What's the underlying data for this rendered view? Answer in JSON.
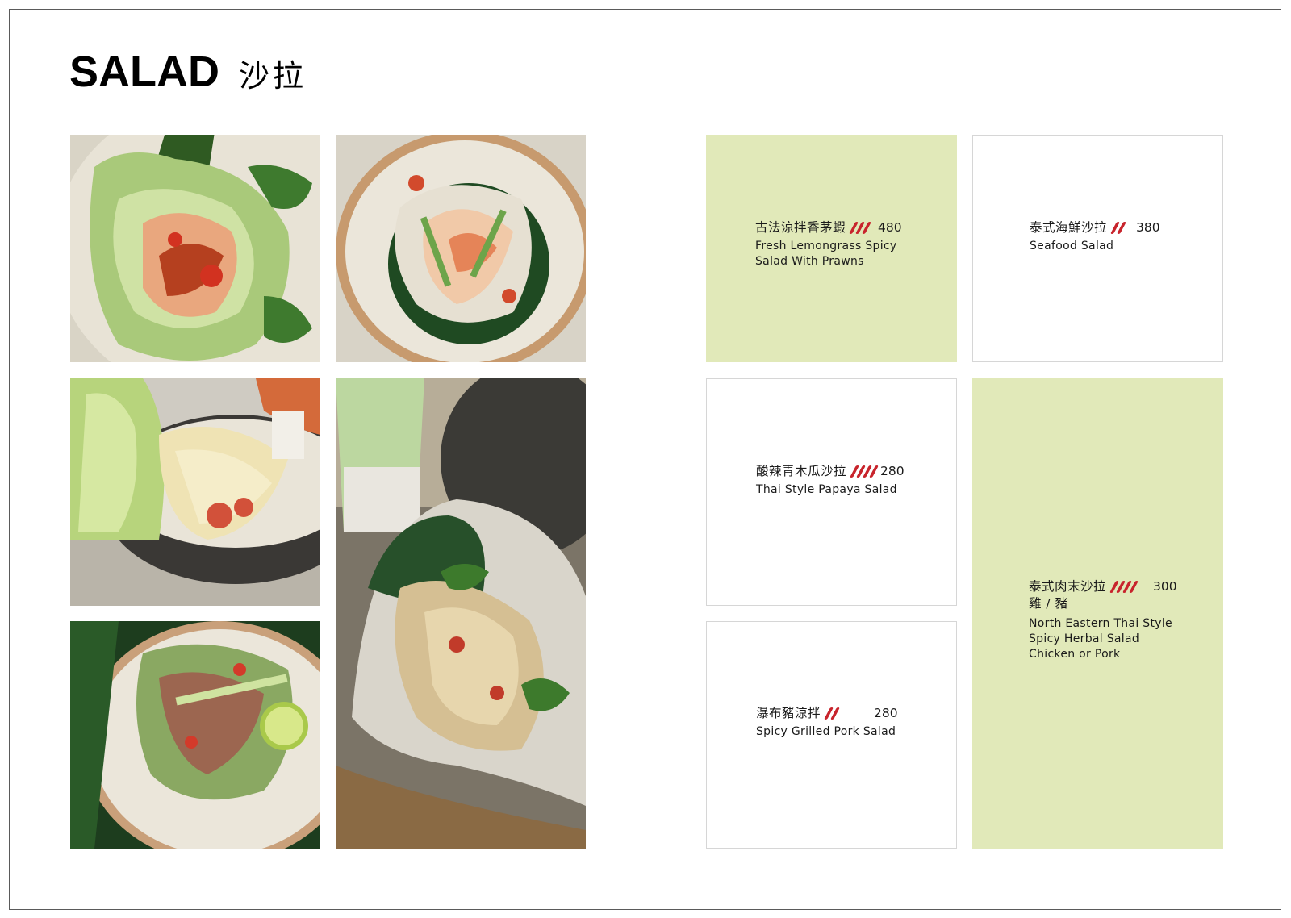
{
  "header": {
    "title_en": "SALAD",
    "title_zh": "沙拉"
  },
  "photos": [
    {
      "subject": "lemongrass prawn salad in lettuce"
    },
    {
      "subject": "seafood salad on plate"
    },
    {
      "subject": "papaya salad in bowl"
    },
    {
      "subject": "grilled pork salad with lime"
    },
    {
      "subject": "herbal salad in banana leaf"
    }
  ],
  "menu": {
    "items": [
      {
        "zh": "古法涼拌香茅蝦",
        "spice": 3,
        "price": "480",
        "en": [
          "Fresh Lemongrass Spicy",
          "Salad With Prawns"
        ],
        "bg": "#e1e9b9"
      },
      {
        "zh": "泰式海鮮沙拉",
        "spice": 2,
        "price": "380",
        "en": [
          "Seafood Salad"
        ],
        "bg": "#ffffff"
      },
      {
        "zh": "酸辣青木瓜沙拉",
        "spice": 4,
        "price": "280",
        "en": [
          "Thai Style Papaya Salad"
        ],
        "bg": "#ffffff"
      },
      {
        "zh": "瀑布豬涼拌",
        "spice": 2,
        "price": "280",
        "en": [
          "Spicy Grilled Pork Salad"
        ],
        "bg": "#ffffff"
      },
      {
        "zh": "泰式肉末沙拉",
        "spice": 4,
        "price": "300",
        "sub_zh": "雞 / 豬",
        "en": [
          "North Eastern Thai Style",
          "Spicy Herbal Salad",
          "Chicken or Pork"
        ],
        "bg": "#e1e9b9"
      }
    ]
  },
  "colors": {
    "card_green": "#e1e9b9",
    "chili_red": "#c8242c",
    "border": "#5a5a5a"
  }
}
